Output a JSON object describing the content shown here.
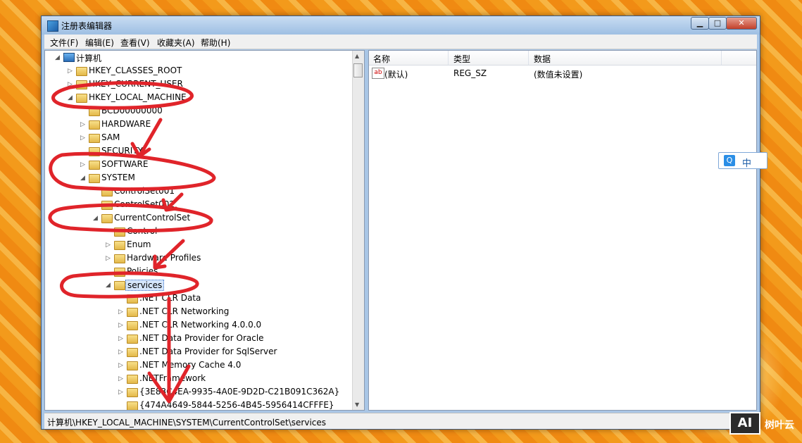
{
  "window": {
    "title": "注册表编辑器"
  },
  "menu": [
    "文件(F)",
    "编辑(E)",
    "查看(V)",
    "收藏夹(A)",
    "帮助(H)"
  ],
  "tree": [
    {
      "label": "计算机",
      "depth": 0,
      "expander": "◢",
      "icon": "computer"
    },
    {
      "label": "HKEY_CLASSES_ROOT",
      "depth": 1,
      "expander": "▷",
      "icon": "folder"
    },
    {
      "label": "HKEY_CURRENT_USER",
      "depth": 1,
      "expander": "▷",
      "icon": "folder"
    },
    {
      "label": "HKEY_LOCAL_MACHINE",
      "depth": 1,
      "expander": "◢",
      "icon": "folder"
    },
    {
      "label": "BCD00000000",
      "depth": 2,
      "expander": "",
      "icon": "folder"
    },
    {
      "label": "HARDWARE",
      "depth": 2,
      "expander": "▷",
      "icon": "folder"
    },
    {
      "label": "SAM",
      "depth": 2,
      "expander": "▷",
      "icon": "folder"
    },
    {
      "label": "SECURITY",
      "depth": 2,
      "expander": "",
      "icon": "folder"
    },
    {
      "label": "SOFTWARE",
      "depth": 2,
      "expander": "▷",
      "icon": "folder"
    },
    {
      "label": "SYSTEM",
      "depth": 2,
      "expander": "◢",
      "icon": "folder"
    },
    {
      "label": "ControlSet001",
      "depth": 3,
      "expander": "",
      "icon": "folder"
    },
    {
      "label": "ControlSet002",
      "depth": 3,
      "expander": "",
      "icon": "folder"
    },
    {
      "label": "CurrentControlSet",
      "depth": 3,
      "expander": "◢",
      "icon": "folder"
    },
    {
      "label": "Control",
      "depth": 4,
      "expander": "",
      "icon": "folder"
    },
    {
      "label": "Enum",
      "depth": 4,
      "expander": "▷",
      "icon": "folder"
    },
    {
      "label": "Hardware Profiles",
      "depth": 4,
      "expander": "▷",
      "icon": "folder"
    },
    {
      "label": "Policies",
      "depth": 4,
      "expander": "",
      "icon": "folder"
    },
    {
      "label": "services",
      "depth": 4,
      "expander": "◢",
      "icon": "folder",
      "selected": true
    },
    {
      "label": ".NET CLR Data",
      "depth": 5,
      "expander": "",
      "icon": "folder"
    },
    {
      "label": ".NET CLR Networking",
      "depth": 5,
      "expander": "▷",
      "icon": "folder"
    },
    {
      "label": ".NET CLR Networking 4.0.0.0",
      "depth": 5,
      "expander": "▷",
      "icon": "folder"
    },
    {
      "label": ".NET Data Provider for Oracle",
      "depth": 5,
      "expander": "▷",
      "icon": "folder"
    },
    {
      "label": ".NET Data Provider for SqlServer",
      "depth": 5,
      "expander": "▷",
      "icon": "folder"
    },
    {
      "label": ".NET Memory Cache 4.0",
      "depth": 5,
      "expander": "▷",
      "icon": "folder"
    },
    {
      "label": ".NETFramework",
      "depth": 5,
      "expander": "▷",
      "icon": "folder"
    },
    {
      "label": "{3E83C4EA-9935-4A0E-9D2D-C21B091C362A}",
      "depth": 5,
      "expander": "▷",
      "icon": "folder"
    },
    {
      "label": "{474A4649-5844-5256-4B45-5956414CFFFE}",
      "depth": 5,
      "expander": "",
      "icon": "folder"
    }
  ],
  "list": {
    "columns": [
      "名称",
      "类型",
      "数据"
    ],
    "rows": [
      {
        "name": "(默认)",
        "type": "REG_SZ",
        "data": "(数值未设置)",
        "icon": "ab"
      }
    ]
  },
  "status": "计算机\\HKEY_LOCAL_MACHINE\\SYSTEM\\CurrentControlSet\\services",
  "ime": {
    "q": "Q",
    "mode": "中"
  },
  "watermark": {
    "logo": "AI",
    "text": "树叶云"
  },
  "colors": {
    "annotation": "#e0242a",
    "selection": "#d5e6fb"
  }
}
